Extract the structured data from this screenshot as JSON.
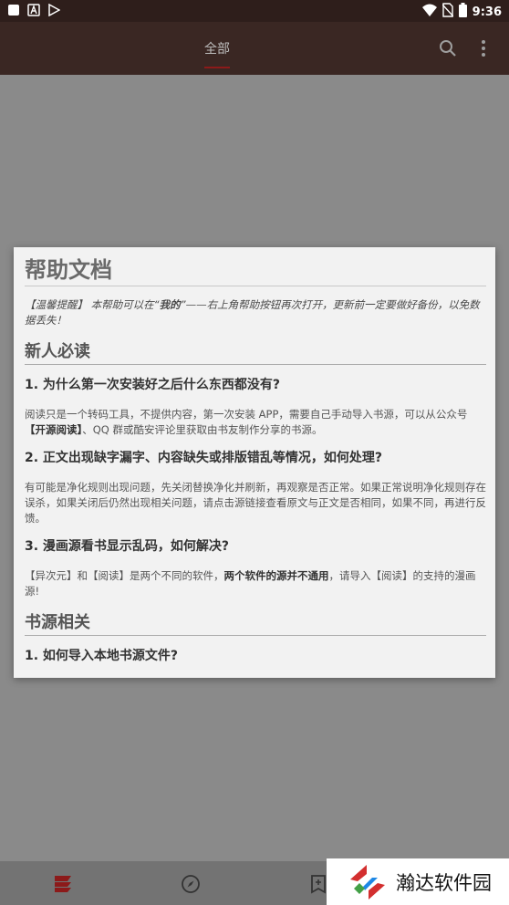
{
  "status_bar": {
    "time": "9:36",
    "left_icons": [
      "square-icon",
      "a-icon",
      "play-icon"
    ],
    "right_icons": [
      "wifi-icon",
      "no-sim-icon",
      "battery-icon"
    ]
  },
  "toolbar": {
    "tab_label": "全部",
    "search_icon": "search-icon",
    "more_icon": "more-vert-icon",
    "accent": "#8c1a1a"
  },
  "dialog": {
    "title": "帮助文档",
    "tip": {
      "prefix": "【温馨提醒】",
      "text_a": " 本帮助可以在“",
      "text_bold": "我的",
      "text_b": "”——右上角帮助按钮再次打开，更新前一定要做好备份，以免数据丢失！"
    },
    "sections": [
      {
        "heading": "新人必读"
      },
      {
        "heading": "书源相关"
      }
    ],
    "q1": {
      "question": "1. 为什么第一次安装好之后什么东西都没有?",
      "a1": "阅读只是一个转码工具，不提供内容，第一次安装 APP，需要自己手动导入书源，可以从公众号 ",
      "a_bold": "【开源阅读】",
      "a2": "、QQ 群或酷安评论里获取由书友制作分享的书源。"
    },
    "q2": {
      "question": "2. 正文出现缺字漏字、内容缺失或排版错乱等情况，如何处理?",
      "answer": "有可能是净化规则出现问题，先关闭替换净化并刷新，再观察是否正常。如果正常说明净化规则存在误杀，如果关闭后仍然出现相关问题，请点击源链接查看原文与正文是否相同，如果不同，再进行反馈。"
    },
    "q3": {
      "question": "3. 漫画源看书显示乱码，如何解决?",
      "a1": "【异次元】和【阅读】是两个不同的软件，",
      "a_bold": "两个软件的源并不通用",
      "a2": "，请导入【阅读】的支持的漫画源!"
    },
    "q4": {
      "question": "1. 如何导入本地书源文件?"
    }
  },
  "bottom_nav": {
    "items": [
      "bookshelf-icon",
      "explore-icon",
      "rss-icon"
    ],
    "active_color": "#8c1a1a"
  },
  "watermark": {
    "text": "瀚达软件园"
  }
}
